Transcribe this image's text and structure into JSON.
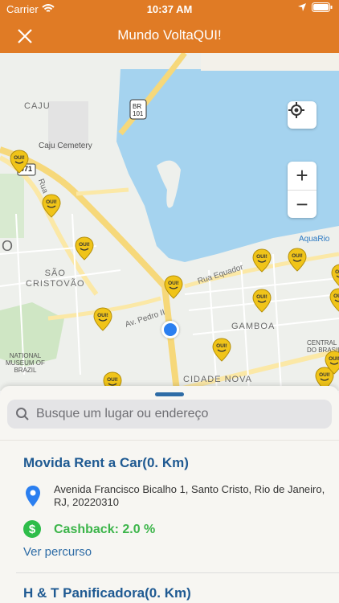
{
  "status": {
    "carrier": "Carrier",
    "time": "10:37 AM"
  },
  "nav": {
    "title": "Mundo VoltaQUI!"
  },
  "map": {
    "labels": {
      "caju": "CAJU",
      "caju_cemetery": "Caju Cemetery",
      "br101": "BR\n101",
      "road_071": "071",
      "rua": "Rua",
      "sao_cristovao": "SÃO\nCRISTOVÃO",
      "o_letter": "O",
      "av_pedro": "Av. Pedro II",
      "rua_equador": "Rua Equador",
      "gamboa": "GAMBOA",
      "aquario": "AquaRio",
      "national_museum": "NATIONAL\nMUSEUM OF\nBRAZIL",
      "central": "CENTRAL\nDO BRASIL",
      "cidade_nova": "CIDADE NOVA"
    },
    "pin_label": "OUI!",
    "zoom_in": "+",
    "zoom_out": "−"
  },
  "sheet": {
    "search_placeholder": "Busque um lugar ou endereço",
    "items": [
      {
        "name": "Movida Rent a Car(0. Km)",
        "address": "Avenida Francisco Bicalho 1, Santo Cristo, Rio de Janeiro, RJ, 20220310",
        "cashback": "Cashback: 2.0 %",
        "cash_symbol": "$",
        "route": "Ver percurso"
      },
      {
        "name": "H & T Panificadora(0. Km)"
      }
    ]
  },
  "colors": {
    "brand": "#e07b25",
    "link": "#2e6ca6",
    "cashback": "#3cb54a",
    "water": "#a5d3ef"
  }
}
